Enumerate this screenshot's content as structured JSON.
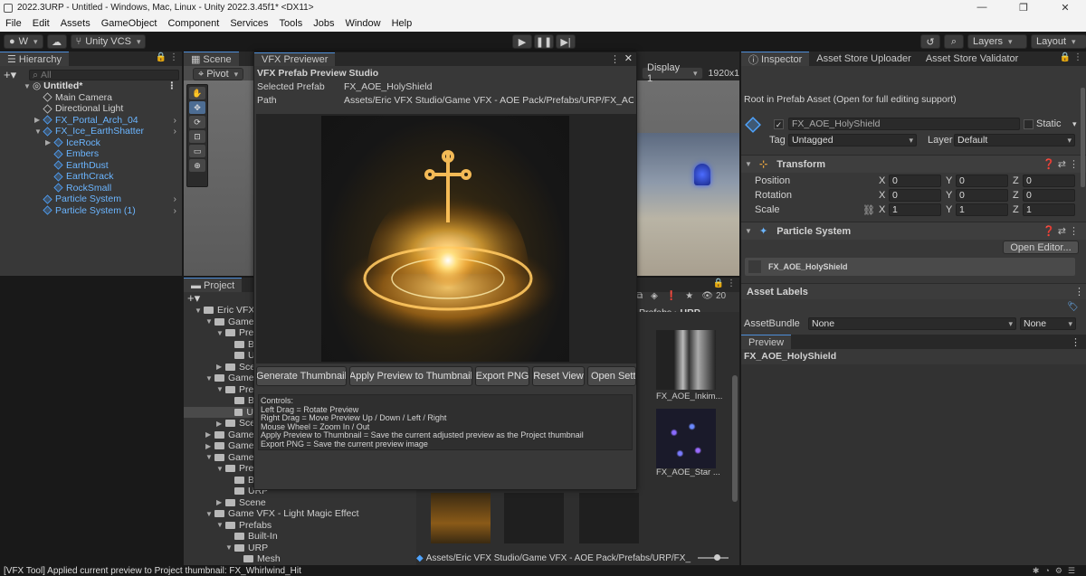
{
  "titlebar": {
    "title": "2022.3URP - Untitled - Windows, Mac, Linux - Unity 2022.3.45f1* <DX11>",
    "minimize": "—",
    "maximize": "❐",
    "close": "✕"
  },
  "menu": [
    "File",
    "Edit",
    "Assets",
    "GameObject",
    "Component",
    "Services",
    "Tools",
    "Jobs",
    "Window",
    "Help"
  ],
  "toolbar": {
    "account": "W",
    "vcs": "Unity VCS",
    "layers": "Layers",
    "layout": "Layout"
  },
  "hierarchy": {
    "tab": "Hierarchy",
    "search_placeholder": "All",
    "scene": "Untitled*",
    "items": [
      {
        "label": "Main Camera"
      },
      {
        "label": "Directional Light"
      },
      {
        "label": "FX_Portal_Arch_04"
      },
      {
        "label": "FX_Ice_EarthShatter"
      },
      {
        "label": "IceRock"
      },
      {
        "label": "Embers"
      },
      {
        "label": "EarthDust"
      },
      {
        "label": "EarthCrack"
      },
      {
        "label": "RockSmall"
      },
      {
        "label": "Particle System"
      },
      {
        "label": "Particle System (1)"
      }
    ]
  },
  "scene": {
    "tab": "Scene",
    "pivot": "Pivot",
    "display": "Display 1",
    "resolution": "1920x1"
  },
  "project": {
    "tab": "Project",
    "tree": [
      "Eric VFX",
      "Game",
      "Prefa",
      "Bu",
      "U",
      "Scen",
      "Game",
      "Pref",
      "Bu",
      "U",
      "Scen",
      "Game",
      "Game",
      "Game",
      "Pref",
      "Bu",
      "URP",
      "Scene",
      "Game VFX - Light Magic Effect",
      "Prefabs",
      "Built-In",
      "URP",
      "Mesh"
    ],
    "breadcrumb_prefabs": "Prefabs",
    "breadcrumb_urp": "URP",
    "count": "20",
    "thumbs": [
      {
        "label": "FX_AOE_Inkim..."
      },
      {
        "label": "FX_AOE_Star ..."
      }
    ],
    "path": "Assets/Eric VFX Studio/Game VFX - AOE Pack/Prefabs/URP/FX_"
  },
  "inspector": {
    "tabs": [
      "Inspector",
      "Asset Store Uploader",
      "Asset Store Validator"
    ],
    "prefab_notice": "Root in Prefab Asset (Open for full editing support)",
    "object_name": "FX_AOE_HolyShield",
    "static_label": "Static",
    "tag_label": "Tag",
    "tag_value": "Untagged",
    "layer_label": "Layer",
    "layer_value": "Default",
    "transform": {
      "title": "Transform",
      "position_label": "Position",
      "rotation_label": "Rotation",
      "scale_label": "Scale",
      "position": {
        "x": "0",
        "y": "0",
        "z": "0"
      },
      "rotation": {
        "x": "0",
        "y": "0",
        "z": "0"
      },
      "scale": {
        "x": "1",
        "y": "1",
        "z": "1"
      }
    },
    "particle_system": {
      "title": "Particle System",
      "open_editor": "Open Editor...",
      "name": "FX_AOE_HolyShield"
    },
    "asset_labels": "Asset Labels",
    "asset_bundle_label": "AssetBundle",
    "asset_bundle_value": "None",
    "asset_bundle_variant": "None",
    "preview_tab": "Preview",
    "preview_name": "FX_AOE_HolyShield",
    "axis": {
      "x": "X",
      "y": "Y",
      "z": "Z"
    }
  },
  "vfx": {
    "tab": "VFX Previewer",
    "heading": "VFX Prefab Preview Studio",
    "selected_label": "Selected Prefab",
    "selected_value": "FX_AOE_HolyShield",
    "path_label": "Path",
    "path_value": "Assets/Eric VFX Studio/Game VFX - AOE Pack/Prefabs/URP/FX_AOE_Hc",
    "buttons": {
      "generate": "Generate Thumbnail",
      "apply": "Apply Preview to Thumbnail",
      "export": "Export PNG",
      "reset": "Reset View",
      "settings": "Open Settin"
    },
    "help": [
      "Controls:",
      "Left Drag = Rotate Preview",
      "Right Drag = Move Preview Up / Down / Left / Right",
      "Mouse Wheel = Zoom In / Out",
      "Apply Preview to Thumbnail = Save the current adjusted preview as the Project thumbnail",
      "Export PNG = Save the current preview image"
    ]
  },
  "status": {
    "message": "[VFX Tool] Applied current preview to Project thumbnail: FX_Whirlwind_Hit"
  }
}
